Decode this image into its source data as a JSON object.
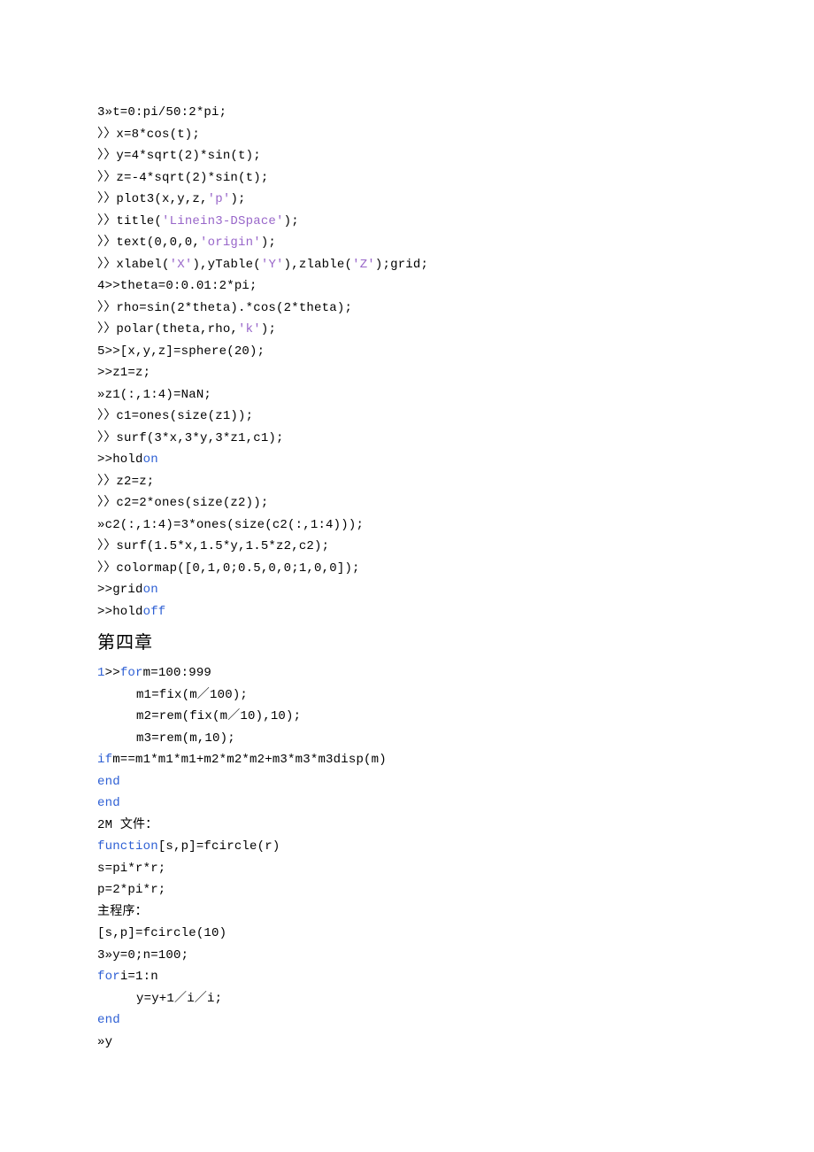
{
  "lines": [
    {
      "cls": "code-line",
      "html": "3»t=0:pi/50:2*pi;"
    },
    {
      "cls": "code-line",
      "html": "〉〉x=8*cos(t);"
    },
    {
      "cls": "code-line",
      "html": "〉〉y=4*sqrt(2)*sin(t);"
    },
    {
      "cls": "code-line",
      "html": "〉〉z=-4*sqrt(2)*sin(t);"
    },
    {
      "cls": "code-line",
      "html": "〉〉plot3(x,y,z,<span class=\"str\">'p'</span>);"
    },
    {
      "cls": "code-line",
      "html": "〉〉title(<span class=\"str\">'Linein3-DSpace'</span>);"
    },
    {
      "cls": "code-line",
      "html": "〉〉text(0,0,0,<span class=\"str\">'origin'</span>);"
    },
    {
      "cls": "code-line",
      "html": "〉〉xlabel(<span class=\"str\">'X'</span>),yTable(<span class=\"str\">'Y'</span>),zlable(<span class=\"str\">'Z'</span>);grid;"
    },
    {
      "cls": "code-line",
      "html": "4>>theta=0:0.01:2*pi;"
    },
    {
      "cls": "code-line",
      "html": "〉〉rho=sin(2*theta).*cos(2*theta);"
    },
    {
      "cls": "code-line",
      "html": "〉〉polar(theta,rho,<span class=\"str\">'k'</span>);"
    },
    {
      "cls": "code-line",
      "html": "5>>[x,y,z]=sphere(20);"
    },
    {
      "cls": "code-line",
      "html": ">>z1=z;"
    },
    {
      "cls": "code-line",
      "html": "»z1(:,1:4)=NaN;"
    },
    {
      "cls": "code-line",
      "html": "〉〉c1=ones(size(z1));"
    },
    {
      "cls": "code-line",
      "html": "〉〉surf(3*x,3*y,3*z1,c1);"
    },
    {
      "cls": "code-line",
      "html": ">>hold<span class=\"kw\">on</span>"
    },
    {
      "cls": "code-line",
      "html": "〉〉z2=z;"
    },
    {
      "cls": "code-line",
      "html": "〉〉c2=2*ones(size(z2));"
    },
    {
      "cls": "code-line",
      "html": "»c2(:,1:4)=3*ones(size(c2(:,1:4)));"
    },
    {
      "cls": "code-line",
      "html": "〉〉surf(1.5*x,1.5*y,1.5*z2,c2);"
    },
    {
      "cls": "code-line",
      "html": "〉〉colormap([0,1,0;0.5,0,0;1,0,0]);"
    },
    {
      "cls": "code-line",
      "html": ">>grid<span class=\"kw\">on</span>"
    },
    {
      "cls": "code-line",
      "html": ">>hold<span class=\"kw\">off</span>"
    },
    {
      "cls": "heading",
      "html": "第四章"
    },
    {
      "cls": "code-line",
      "html": "<span class=\"num\">1</span>>><span class=\"kw\">for</span>m=100:999"
    },
    {
      "cls": "code-line ind1",
      "html": "m1=fix(m／100);"
    },
    {
      "cls": "code-line ind1",
      "html": "m2=rem(fix(m／10),10);"
    },
    {
      "cls": "code-line ind1",
      "html": "m3=rem(m,10);"
    },
    {
      "cls": "code-line",
      "html": "<span class=\"kw\">if</span>m==m1*m1*m1+m2*m2*m2+m3*m3*m3disp(m)"
    },
    {
      "cls": "code-line",
      "html": "<span class=\"kw\">end</span>"
    },
    {
      "cls": "code-line",
      "html": "<span class=\"kw\">end</span>"
    },
    {
      "cls": "code-line",
      "html": "2M <span class=\"cn\">文件：</span>"
    },
    {
      "cls": "code-line",
      "html": "<span class=\"kw\">function</span>[s,p]=fcircle(r)"
    },
    {
      "cls": "code-line",
      "html": "s=pi*r*r;"
    },
    {
      "cls": "code-line",
      "html": "p=2*pi*r;"
    },
    {
      "cls": "code-line",
      "html": "<span class=\"cn\">主程序：</span>"
    },
    {
      "cls": "code-line",
      "html": "[s,p]=fcircle(10)"
    },
    {
      "cls": "code-line",
      "html": "3»y=0;n=100;"
    },
    {
      "cls": "code-line",
      "html": "<span class=\"kw\">for</span>i=1:n"
    },
    {
      "cls": "code-line ind1",
      "html": "y=y+1／i／i;"
    },
    {
      "cls": "code-line",
      "html": "<span class=\"kw\">end</span>"
    },
    {
      "cls": "code-line",
      "html": "»y"
    }
  ]
}
